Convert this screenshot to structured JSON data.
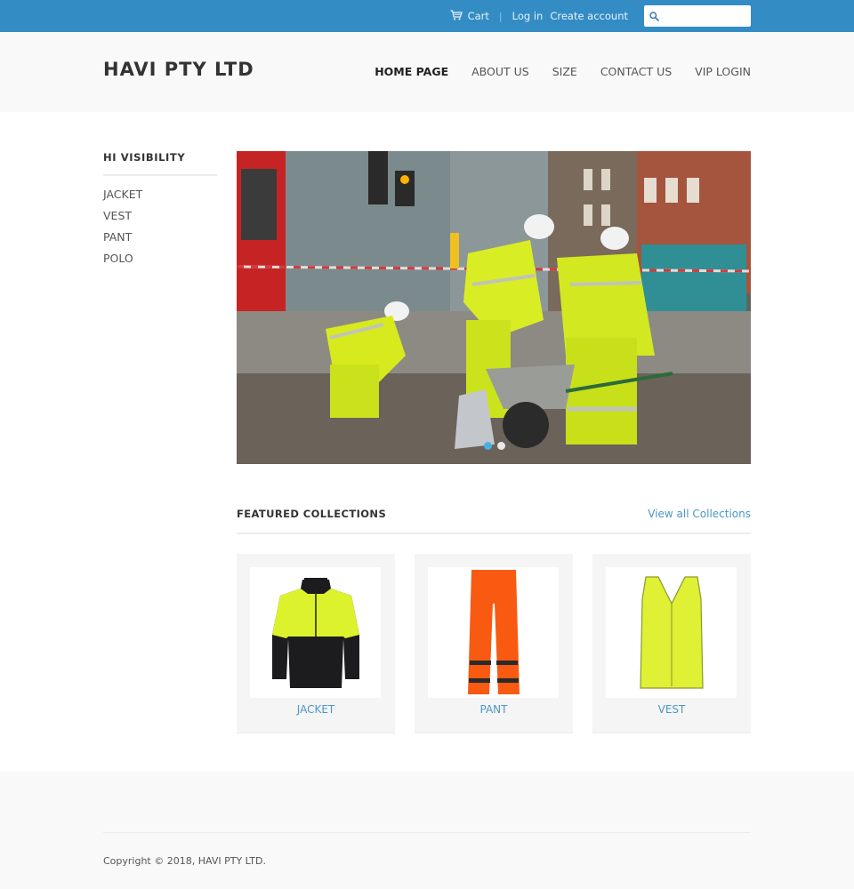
{
  "topbar": {
    "cart_label": "Cart",
    "login_label": "Log in",
    "create_account_label": "Create account",
    "search_placeholder": "",
    "search_value": "",
    "bg_color": "#348cc4"
  },
  "header": {
    "logo": "HAVI PTY LTD",
    "nav": [
      {
        "label": "HOME PAGE",
        "active": true
      },
      {
        "label": "ABOUT US"
      },
      {
        "label": "SIZE"
      },
      {
        "label": "CONTACT US"
      },
      {
        "label": "VIP LOGIN"
      }
    ]
  },
  "sidebar": {
    "title": "HI VISIBILITY",
    "items": [
      "JACKET",
      "VEST",
      "PANT",
      "POLO"
    ]
  },
  "slider": {
    "image_alt": "Road workers in hi-visibility yellow workwear with a wheelbarrow on a city street",
    "slide_count": 2,
    "active_slide": 1
  },
  "featured": {
    "title": "FEATURED COLLECTIONS",
    "view_all_label": "View all Collections",
    "collections": [
      {
        "label": "JACKET",
        "image": "hi-vis-jacket"
      },
      {
        "label": "PANT",
        "image": "hi-vis-pant"
      },
      {
        "label": "VEST",
        "image": "hi-vis-vest"
      }
    ]
  },
  "footer": {
    "copyright": "Copyright © 2018, HAVI PTY LTD."
  },
  "colors": {
    "accent_link": "#4a97c6",
    "dot_active": "#49b0e6"
  }
}
